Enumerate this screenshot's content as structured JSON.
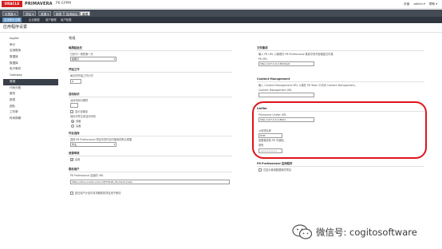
{
  "header": {
    "logo": "ORACLE",
    "brand": "PRIMAVERA",
    "product": "P6 EPPM",
    "user_links": [
      "页面",
      "admin ▾",
      "帮助 ▾"
    ]
  },
  "main_nav": [
    "仪表盘 ▾",
    "项目 ▾",
    "资源 ▾",
    "报表",
    "投资组合",
    "管理"
  ],
  "sub_nav": [
    "应用程序设置",
    "企业数据",
    "用户管理",
    "用户权限"
  ],
  "page_title": "应用程序设置",
  "sidebar": {
    "items": [
      "Applet",
      "审计",
      "应用程序",
      "数据库",
      "数据库",
      "电子邮件",
      "Gateway",
      "常规",
      "代码分配",
      "服务",
      "报表",
      "团队",
      "工时单",
      "时间周期"
    ],
    "active_index": 7
  },
  "general": {
    "section_title": "常规",
    "work_week": {
      "title": "每周起始日",
      "label": "日历中一周的第一天",
      "value": "星期日"
    },
    "workday": {
      "title": "开始工作",
      "label": "每天的开始工作小时",
      "value": "8"
    },
    "activity_ids": {
      "title": "活动标识",
      "label": "活动代码分隔符",
      "value": ".",
      "checkbox_label": "显示全路径",
      "options_label": "用标识符生成活动代码",
      "options": [
        "前缀",
        "后缀"
      ]
    },
    "project_activity": {
      "title": "作业选择",
      "label": "选择 P6 Professional 项目中的作业时使用的默认视图",
      "value": "作业"
    },
    "resource": {
      "title": "资源审核",
      "checkbox_label": "启用"
    },
    "cloud": {
      "title": "联机用户",
      "label": "P6 Professional 连接的 URL",
      "value": "https://docs.oracle.com/cd/E75428_01/client_help/"
    },
    "bottom_checkbox_label": "如在用户计划中将未删除的项目用于移动"
  },
  "right": {
    "integration": {
      "title": "文件集成",
      "desc": "输入 P6 URL 以管理与 P6 Professional 集成中的外部链接文件集",
      "label": "P6 URL",
      "value": "http://127.0.0.1:8203/p6"
    },
    "content_management": {
      "title": "Content Management",
      "desc": "输入 Content Management URL 以便在 P6 Team 中访问 Content Management。",
      "label": "Content Management URL"
    },
    "unifier": {
      "title": "Unifier",
      "label": "Primavera Unifier URL",
      "url": "http://127.0.0.1:8001",
      "company_label": "公司短名称",
      "company": "PCM",
      "note": "如果集成到 P6 中使用。",
      "pwd_label": "密码",
      "pwd": "••••••••••••"
    },
    "pro": {
      "title": "P6 Professional 应用程序",
      "checkbox_label": "仅显示使用数据库的项目"
    }
  },
  "watermark": {
    "text": "微信号: cogitosoftware"
  }
}
